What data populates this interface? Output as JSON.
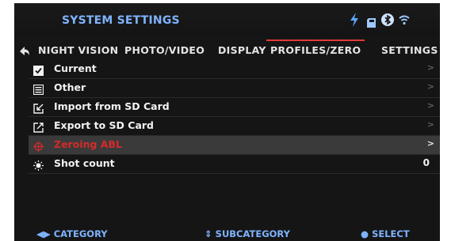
{
  "header": {
    "title": "SYSTEM SETTINGS",
    "icons": [
      "lightning-icon",
      "sd-card-icon",
      "bluetooth-icon",
      "wifi-icon"
    ]
  },
  "tabs": [
    {
      "label": "NIGHT VISION"
    },
    {
      "label": "PHOTO/VIDEO"
    },
    {
      "label": "DISPLAY"
    },
    {
      "label": "PROFILES/ZERO",
      "active": true
    },
    {
      "label": "SETTINGS"
    }
  ],
  "menu": [
    {
      "label": "Current",
      "icon": "checkbox-icon"
    },
    {
      "label": "Other",
      "icon": "list-icon"
    },
    {
      "label": "Import from SD Card",
      "icon": "import-icon"
    },
    {
      "label": "Export to SD Card",
      "icon": "export-icon"
    },
    {
      "label": "Zeroing ABL",
      "icon": "crosshair-icon",
      "selected": true
    },
    {
      "label": "Shot count",
      "icon": "shot-icon",
      "value": "0"
    }
  ],
  "footer": {
    "category": "CATEGORY",
    "subcategory": "SUBCATEGORY",
    "select": "SELECT"
  },
  "colors": {
    "accent_blue": "#7fb3ff",
    "active_red": "#d52a2a",
    "background": "#151515",
    "selected_row": "#3a3a3a"
  }
}
